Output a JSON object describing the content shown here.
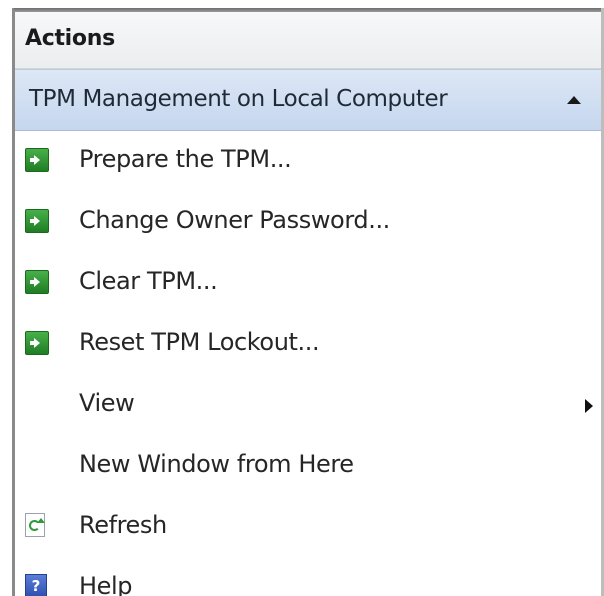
{
  "pane": {
    "title": "Actions"
  },
  "section": {
    "title": "TPM Management on Local Computer"
  },
  "menu": {
    "items": [
      {
        "label": "Prepare the TPM...",
        "icon": "green-action-arrow-icon"
      },
      {
        "label": "Change Owner Password...",
        "icon": "green-action-arrow-icon"
      },
      {
        "label": "Clear TPM...",
        "icon": "green-action-arrow-icon"
      },
      {
        "label": "Reset TPM Lockout...",
        "icon": "green-action-arrow-icon"
      },
      {
        "label": "View",
        "icon": "submenu-arrow-icon"
      },
      {
        "label": "New Window from Here",
        "icon": ""
      },
      {
        "label": "Refresh",
        "icon": "refresh-icon"
      },
      {
        "label": "Help",
        "icon": "help-icon",
        "glyph": "?"
      }
    ]
  }
}
